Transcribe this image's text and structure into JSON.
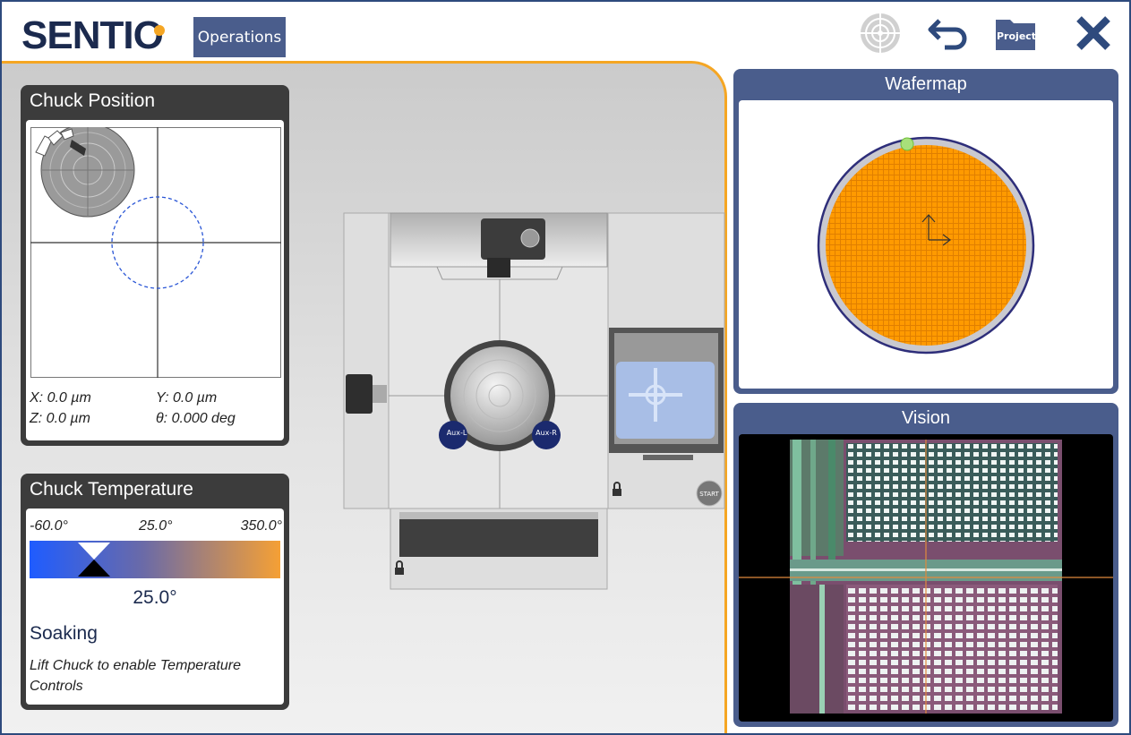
{
  "app": {
    "logo": "SENTIO",
    "operations_label": "Operations",
    "project_label": "Project",
    "icons": {
      "target": "target-icon",
      "undo": "undo-icon",
      "project": "folder-icon",
      "close": "close-icon"
    },
    "accent_color": "#f5a623",
    "brand_color": "#4a5d8c"
  },
  "chuck_position": {
    "title": "Chuck Position",
    "x": "X: 0.0 µm",
    "y": "Y: 0.0 µm",
    "z": "Z: 0.0 µm",
    "theta": "θ: 0.000 deg"
  },
  "chuck_temperature": {
    "title": "Chuck Temperature",
    "min": "-60.0°",
    "setpoint": "25.0°",
    "max": "350.0°",
    "current": "25.0°",
    "status": "Soaking",
    "hint": "Lift Chuck to enable Temperature Controls"
  },
  "station": {
    "aux_left": "Aux-L",
    "aux_right": "Aux-R",
    "start_label": "START"
  },
  "wafermap": {
    "title": "Wafermap"
  },
  "vision": {
    "title": "Vision"
  }
}
